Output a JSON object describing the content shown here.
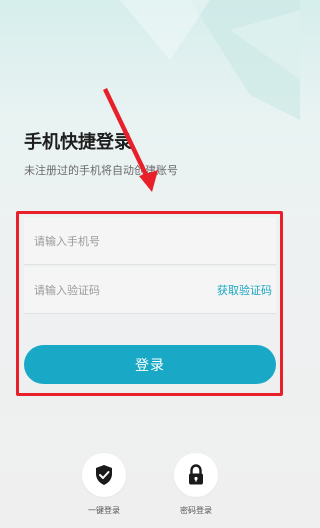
{
  "header": {
    "title": "手机快捷登录",
    "subtitle": "未注册过的手机将自动创建账号"
  },
  "form": {
    "phone_placeholder": "请输入手机号",
    "code_placeholder": "请输入验证码",
    "get_code_label": "获取验证码",
    "login_label": "登录"
  },
  "alt_login": {
    "one_key_label": "一键登录",
    "password_label": "密码登录"
  },
  "colors": {
    "accent": "#19a8c5",
    "link": "#1aa6c2",
    "annotation": "#e8202a"
  },
  "icons": [
    "shield-check-icon",
    "lock-icon"
  ]
}
